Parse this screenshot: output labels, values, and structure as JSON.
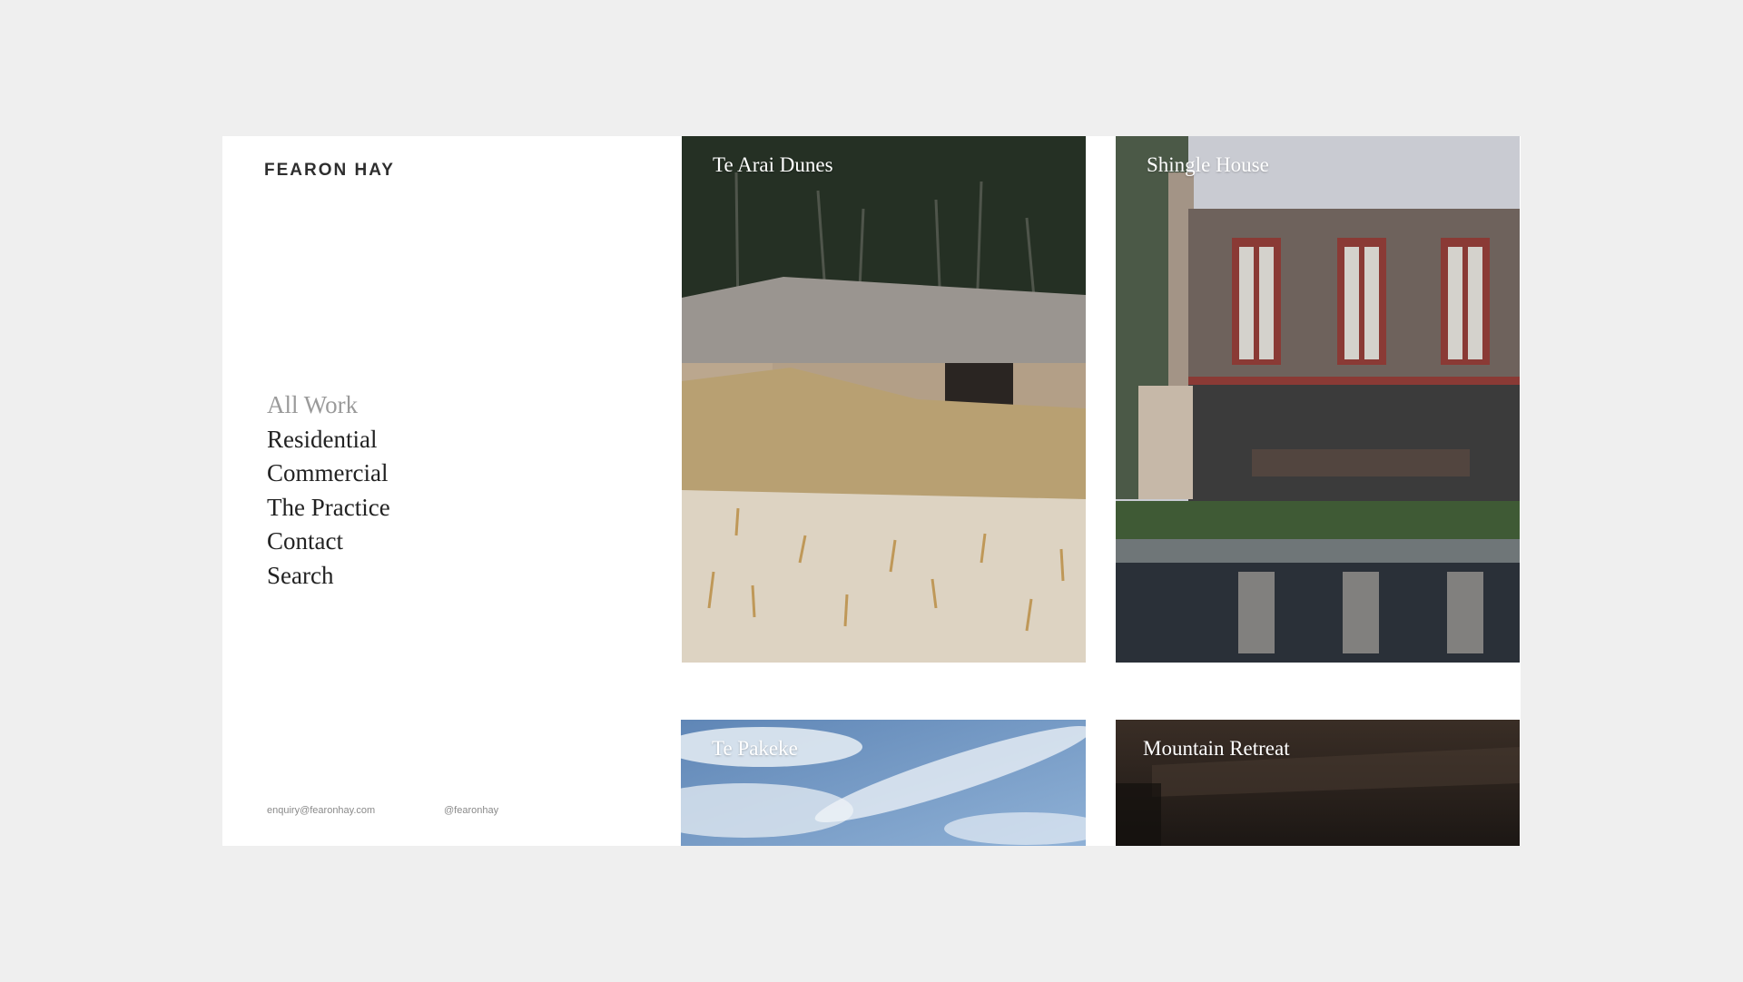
{
  "brand": {
    "name": "FEARON HAY"
  },
  "nav": {
    "items": [
      {
        "label": "All Work",
        "active": true
      },
      {
        "label": "Residential"
      },
      {
        "label": "Commercial"
      },
      {
        "label": "The Practice"
      },
      {
        "label": "Contact"
      },
      {
        "label": "Search"
      }
    ]
  },
  "footer": {
    "email": "enquiry@fearonhay.com",
    "handle": "@fearonhay"
  },
  "projects": [
    {
      "title": "Te Arai Dunes"
    },
    {
      "title": "Shingle House"
    },
    {
      "title": "Te Pakeke"
    },
    {
      "title": "Mountain Retreat"
    }
  ],
  "colors": {
    "page_background": "#efefef",
    "panel": "#ffffff",
    "text": "#222222",
    "muted": "#9a9a9a"
  }
}
